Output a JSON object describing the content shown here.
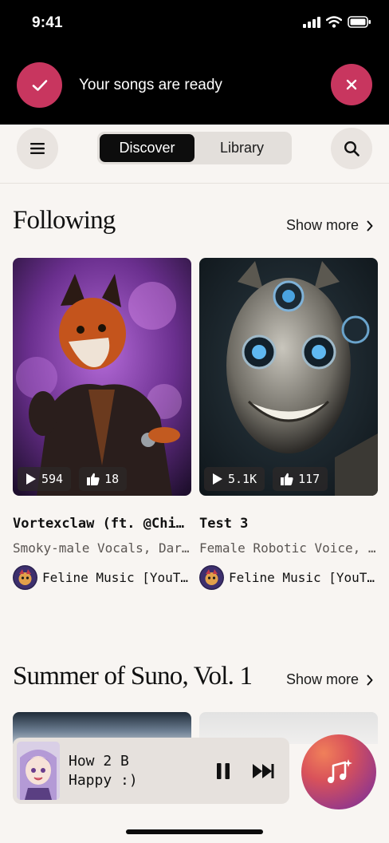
{
  "status_bar": {
    "time": "9:41"
  },
  "toast": {
    "message": "Your songs are ready"
  },
  "nav": {
    "tabs": [
      {
        "label": "Discover",
        "active": true
      },
      {
        "label": "Library",
        "active": false
      }
    ]
  },
  "sections": [
    {
      "title": "Following",
      "show_more": "Show more",
      "cards": [
        {
          "title": "Vortexclaw (ft. @Chibi...",
          "subtitle": "Smoky-male Vocals, Dark...",
          "plays": "594",
          "likes": "18",
          "author": "Feline Music [YouTube]"
        },
        {
          "title": "Test 3",
          "subtitle": "Female Robotic Voice, Cyber...",
          "plays": "5.1K",
          "likes": "117",
          "author": "Feline Music [YouTube]"
        }
      ]
    },
    {
      "title": "Summer of Suno, Vol. 1",
      "show_more": "Show more"
    }
  ],
  "player": {
    "title": "How 2 B Happy :)",
    "playing": true
  },
  "icons": {
    "check": "check-icon",
    "close": "close-icon",
    "menu": "hamburger-icon",
    "search": "search-icon",
    "play": "play-icon",
    "like": "thumbs-up-icon",
    "pause": "pause-icon",
    "next": "skip-forward-icon",
    "create": "music-sparkle-icon"
  },
  "colors": {
    "accent": "#c8365f",
    "background": "#f8f5f2",
    "topbar": "#000000"
  }
}
